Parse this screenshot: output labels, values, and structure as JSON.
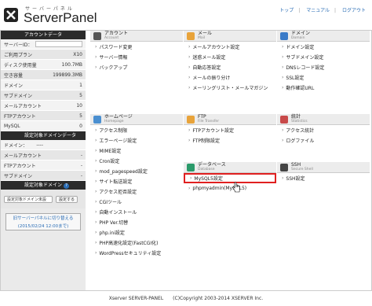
{
  "header": {
    "kana": "サーバーパネル",
    "title": "ServerPanel",
    "links": [
      "トップ",
      "マニュアル",
      "ログアウト"
    ]
  },
  "sidebar": {
    "account_title": "アカウントデータ",
    "rows": [
      {
        "label": "サーバーID：",
        "value": ""
      },
      {
        "label": "ご利用プラン",
        "value": "X10"
      },
      {
        "label": "ディスク使用量",
        "value": "100.7MB"
      },
      {
        "label": "空き容量",
        "value": "199899.3MB"
      },
      {
        "label": "ドメイン",
        "value": "1"
      },
      {
        "label": "サブドメイン",
        "value": "5"
      },
      {
        "label": "メールアカウント",
        "value": "10"
      },
      {
        "label": "FTPアカウント",
        "value": "5"
      },
      {
        "label": "MySQL",
        "value": "0"
      }
    ],
    "domain_data_title": "設定対象ドメインデータ",
    "domain_rows": [
      {
        "label": "ドメイン：",
        "value": "----"
      },
      {
        "label": "メールアカウント",
        "value": "-"
      },
      {
        "label": "FTPアカウント",
        "value": "-"
      },
      {
        "label": "サブドメイン",
        "value": "-"
      }
    ],
    "target_domain_title": "設定対象ドメイン",
    "select_value": "設定対象ドメイン未設",
    "set_button": "設定する",
    "old_panel_text": "旧サーバーパネルに切り替える",
    "old_panel_date": "(2015/02/24 12:00まで)"
  },
  "sections": [
    {
      "title": "アカウント",
      "sub": "Account",
      "color": "#555555",
      "items": [
        "パスワード変更",
        "サーバー情報",
        "バックアップ"
      ]
    },
    {
      "title": "メール",
      "sub": "Mail",
      "color": "#e8a33a",
      "items": [
        "メールアカウント設定",
        "迷惑メール設定",
        "自動応答設定",
        "メールの振り分け",
        "メーリングリスト・メールマガジン"
      ]
    },
    {
      "title": "ドメイン",
      "sub": "Domain",
      "color": "#3a7bc8",
      "items": [
        "ドメイン設定",
        "サブドメイン設定",
        "DNSレコード設定",
        "SSL設定",
        "動作確認URL"
      ]
    },
    {
      "title": "ホームページ",
      "sub": "Homepage",
      "color": "#4a8fd0",
      "items": [
        "アクセス制限",
        "エラーページ設定",
        "MIME設定",
        "Cron設定",
        "mod_pagespeed設定",
        "サイト転送設定",
        "アクセス拒否設定",
        "CGIツール",
        "自動インストール",
        "PHP Ver.切替",
        "php.ini設定",
        "PHP高速化設定(FastCGI化)",
        "WordPressセキュリティ設定"
      ]
    },
    {
      "title": "FTP",
      "sub": "File Transfer",
      "color": "#e8a33a",
      "items": [
        "FTPアカウント設定",
        "FTP制限設定"
      ]
    },
    {
      "title": "統計",
      "sub": "Statistics",
      "color": "#c84a4a",
      "items": [
        "アクセス統計",
        "ログファイル"
      ]
    },
    {
      "title": "データベース",
      "sub": "Database",
      "color": "#2a9a6a",
      "items": [
        "MySQL5設定",
        "phpmyadmin(MySQL5)"
      ]
    },
    {
      "title": "SSH",
      "sub": "Secure Shell",
      "color": "#444444",
      "items": [
        "SSH設定"
      ]
    }
  ],
  "footer": "Xserver SERVER-PANEL　　(C)Copyright 2003-2014 XSERVER Inc."
}
